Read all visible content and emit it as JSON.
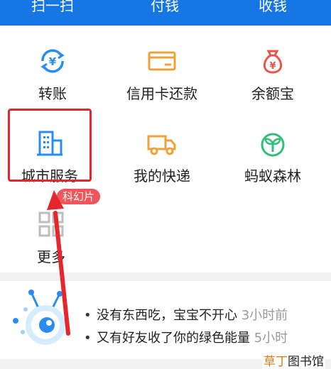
{
  "top_bar": {
    "scan": "扫一扫",
    "pay": "付钱",
    "collect": "收钱"
  },
  "grid": {
    "transfer": "转账",
    "credit_card_repay": "信用卡还款",
    "yuebao": "余额宝",
    "city_service": "城市服务",
    "my_delivery": "我的快递",
    "ant_forest": "蚂蚁森林",
    "more": "更多"
  },
  "badge": "科幻片",
  "feed": {
    "items": [
      {
        "text": "没有东西吃，宝宝不开心",
        "time": "3小时前"
      },
      {
        "text": "又有好友收了你的绿色能量",
        "time": "5小时"
      }
    ]
  },
  "watermark": {
    "part1": "草丁",
    "part2": "图书馆"
  },
  "colors": {
    "top_bar": "#1677e4",
    "highlight": "#e5262a",
    "badge": "#f2545b",
    "icon_blue": "#2a8cf0",
    "icon_orange": "#f0a23a",
    "icon_red": "#e9544d",
    "icon_green": "#2fbf7b"
  }
}
